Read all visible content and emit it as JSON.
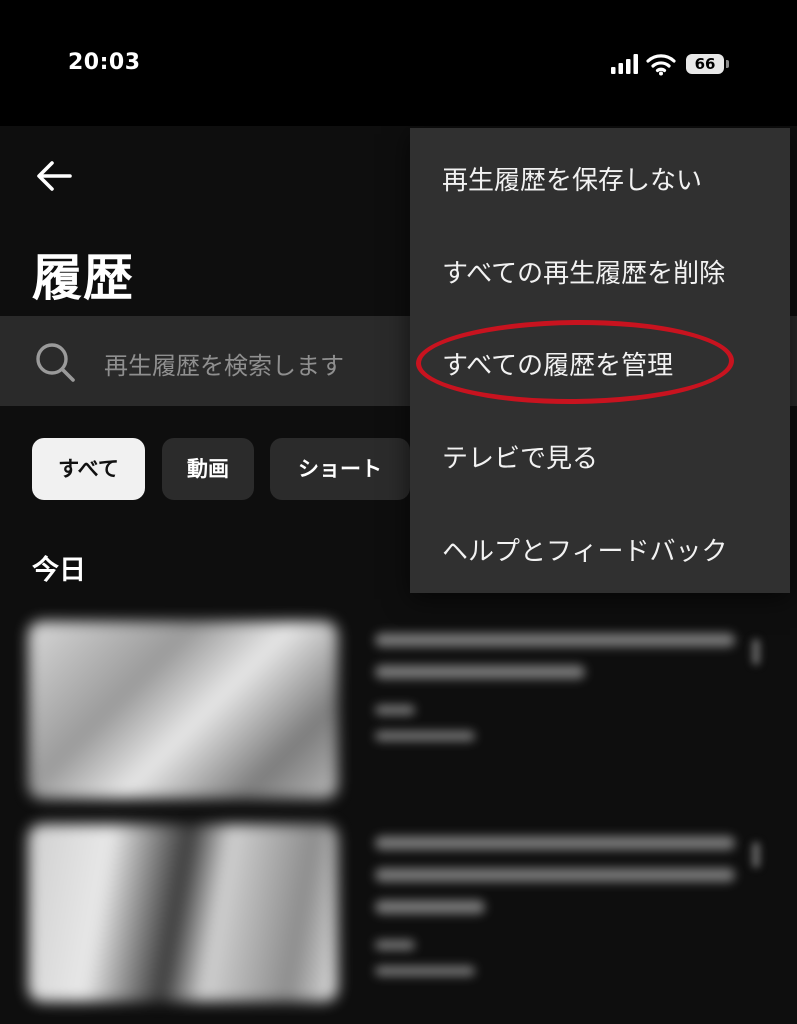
{
  "status_bar": {
    "time": "20:03",
    "battery_level": "66",
    "icons": [
      "signal-icon",
      "wifi-icon",
      "battery-icon"
    ]
  },
  "header": {
    "back_icon": "back-arrow-icon",
    "title": "履歴"
  },
  "search": {
    "icon": "search-icon",
    "placeholder": "再生履歴を検索します"
  },
  "filters": {
    "chips": [
      {
        "label": "すべて",
        "selected": true
      },
      {
        "label": "動画",
        "selected": false
      },
      {
        "label": "ショート",
        "selected": false
      }
    ]
  },
  "section": {
    "today_label": "今日"
  },
  "menu": {
    "items": [
      {
        "label": "再生履歴を保存しない"
      },
      {
        "label": "すべての再生履歴を削除"
      },
      {
        "label": "すべての履歴を管理",
        "highlighted": true
      },
      {
        "label": "テレビで見る"
      },
      {
        "label": "ヘルプとフィードバック"
      }
    ]
  },
  "colors": {
    "background": "#000000",
    "menu_background": "#303030",
    "search_background": "#2a2a2a",
    "chip_selected": "#f1f1f1",
    "chip_unselected": "#2b2b2b",
    "highlight_ring": "#c8131f"
  }
}
